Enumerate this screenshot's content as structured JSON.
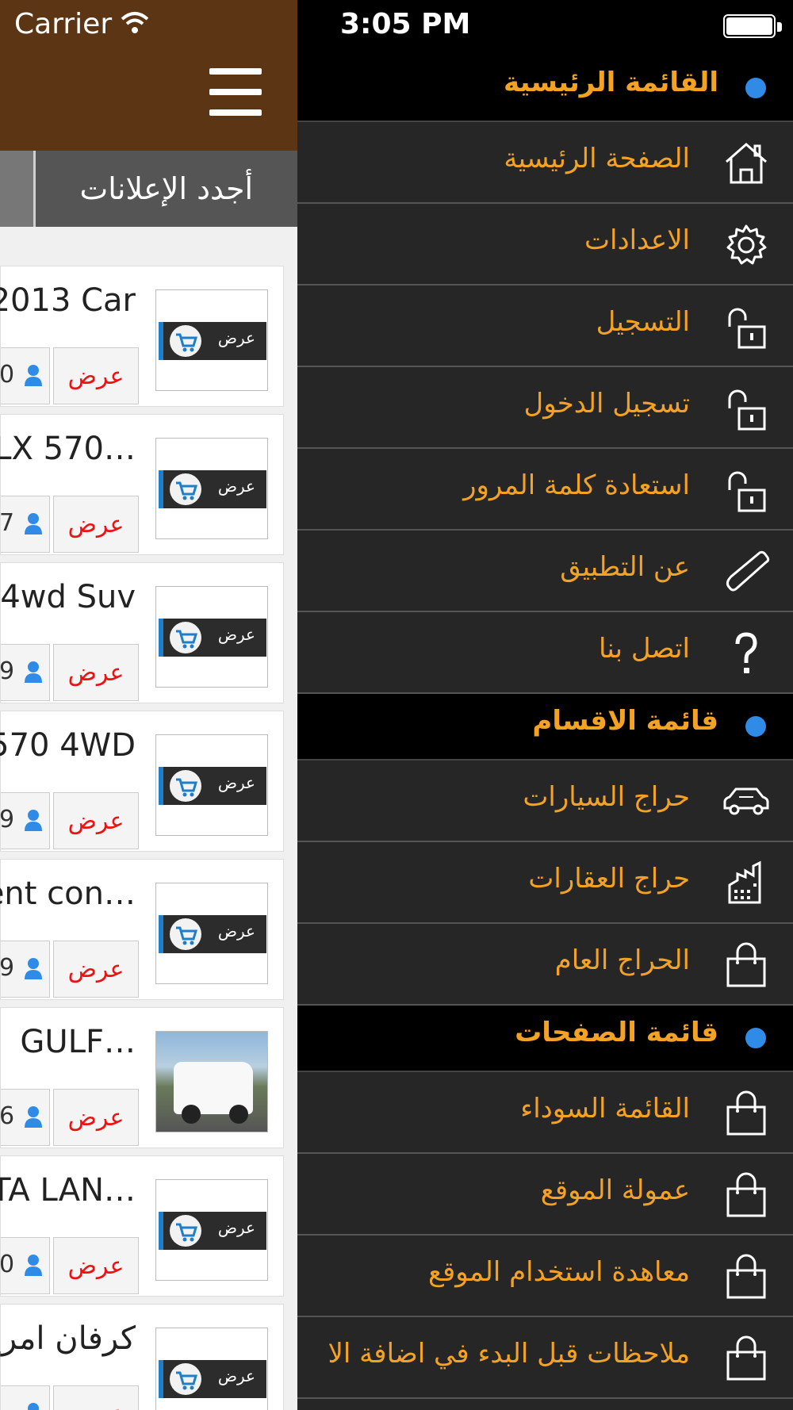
{
  "status_bar": {
    "carrier": "Carrier",
    "time": "3:05 PM"
  },
  "app": {
    "tab_latest": "أجدد الإعلانات",
    "listings": [
      {
        "title": "2013 Car",
        "button": "عرض",
        "views": "0",
        "thumb_text": "عرض",
        "image": "placeholder"
      },
      {
        "title": "LX 570…",
        "button": "عرض",
        "views": "7",
        "thumb_text": "عرض",
        "image": "placeholder"
      },
      {
        "title": "4wd Suv",
        "button": "عرض",
        "views": "9",
        "thumb_text": "عرض",
        "image": "placeholder"
      },
      {
        "title": "570 4WD",
        "button": "عرض",
        "views": "9",
        "thumb_text": "عرض",
        "image": "placeholder"
      },
      {
        "title": "ent con…",
        "button": "عرض",
        "views": "9",
        "thumb_text": "عرض",
        "image": "placeholder"
      },
      {
        "title": "GULF…",
        "button": "عرض",
        "views": "6",
        "thumb_text": "",
        "image": "car-photo"
      },
      {
        "title": "TA LAN…",
        "button": "عرض",
        "views": "0",
        "thumb_text": "عرض",
        "image": "placeholder"
      },
      {
        "title": "كرفان امريك",
        "button": "عرض",
        "views": "",
        "thumb_text": "عرض",
        "image": "placeholder"
      }
    ]
  },
  "menu": {
    "sections": [
      {
        "title": "القائمة الرئيسية",
        "items": [
          {
            "label": "الصفحة  الرئيسية",
            "icon": "home-icon"
          },
          {
            "label": "الاعدادات",
            "icon": "gear-icon"
          },
          {
            "label": "التسجيل",
            "icon": "unlock-icon"
          },
          {
            "label": "تسجيل الدخول",
            "icon": "unlock-icon"
          },
          {
            "label": "استعادة كلمة المرور",
            "icon": "unlock-icon"
          },
          {
            "label": "عن التطبيق",
            "icon": "phone-icon"
          },
          {
            "label": "اتصل بنا",
            "icon": "question-icon"
          }
        ]
      },
      {
        "title": "قائمة الاقسام",
        "items": [
          {
            "label": "حراج السيارات",
            "icon": "car-icon"
          },
          {
            "label": "حراج العقارات",
            "icon": "building-icon"
          },
          {
            "label": "الحراج العام",
            "icon": "bag-icon"
          }
        ]
      },
      {
        "title": "قائمة الصفحات",
        "items": [
          {
            "label": "القائمة السوداء",
            "icon": "bag-icon"
          },
          {
            "label": "عمولة الموقع",
            "icon": "bag-icon"
          },
          {
            "label": "معاهدة استخدام الموقع",
            "icon": "bag-icon"
          },
          {
            "label": "ملاحظات قبل البدء في اضافة الا",
            "icon": "bag-icon"
          }
        ]
      }
    ]
  },
  "colors": {
    "header_brown": "#5b3514",
    "menu_text": "#f4a223",
    "section_dot": "#2f8be6",
    "view_button_text": "#e11111"
  }
}
